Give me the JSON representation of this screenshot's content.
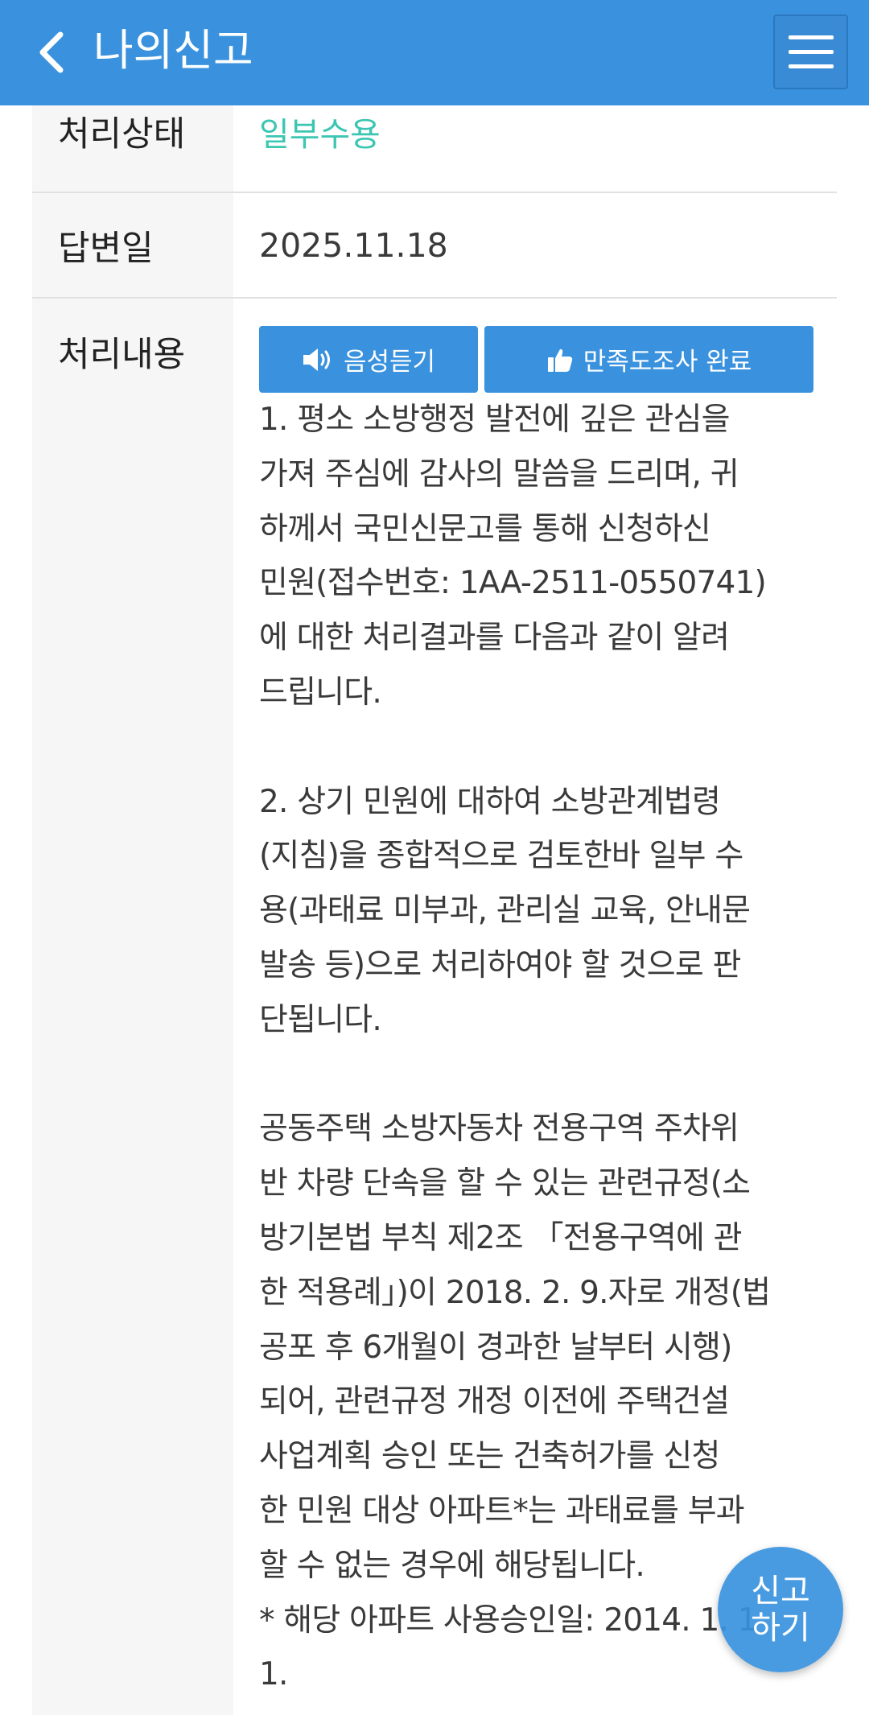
{
  "header": {
    "title": "나의신고",
    "back_icon": "chevron-left-icon",
    "menu_icon": "hamburger-icon",
    "color": "#3a92de"
  },
  "rows": {
    "status": {
      "label": "처리상태",
      "value": "일부수용",
      "value_color": "#3cc6b2"
    },
    "answer_date": {
      "label": "답변일",
      "value": "2025.11.18"
    },
    "content": {
      "label": "처리내용",
      "voice_button": "음성듣기",
      "survey_button": "만족도조사 완료",
      "text": "1. 평소 소방행정 발전에 깊은 관심을\n가져 주심에 감사의 말씀을 드리며, 귀\n하께서 국민신문고를 통해 신청하신\n민원(접수번호: 1AA-2511-0550741)\n에 대한 처리결과를 다음과 같이 알려\n드립니다.\n\n2. 상기 민원에 대하여 소방관계법령\n(지침)을 종합적으로 검토한바 일부 수\n용(과태료 미부과, 관리실 교육, 안내문\n발송 등)으로 처리하여야 할 것으로 판\n단됩니다.\n\n공동주택 소방자동차 전용구역 주차위\n반 차량 단속을 할 수 있는 관련규정(소\n방기본법 부칙 제2조 「전용구역에 관\n한 적용례」)이 2018. 2. 9.자로 개정(법\n공포 후 6개월이 경과한 날부터 시행)\n되어, 관련규정 개정 이전에 주택건설\n사업계획 승인 또는 건축허가를 신청\n한 민원 대상 아파트*는 과태료를 부과\n할 수 없는 경우에 해당됩니다.\n* 해당 아파트 사용승인일: 2014. 1. 1\n1."
    }
  },
  "fab": {
    "line1": "신고",
    "line2": "하기"
  }
}
